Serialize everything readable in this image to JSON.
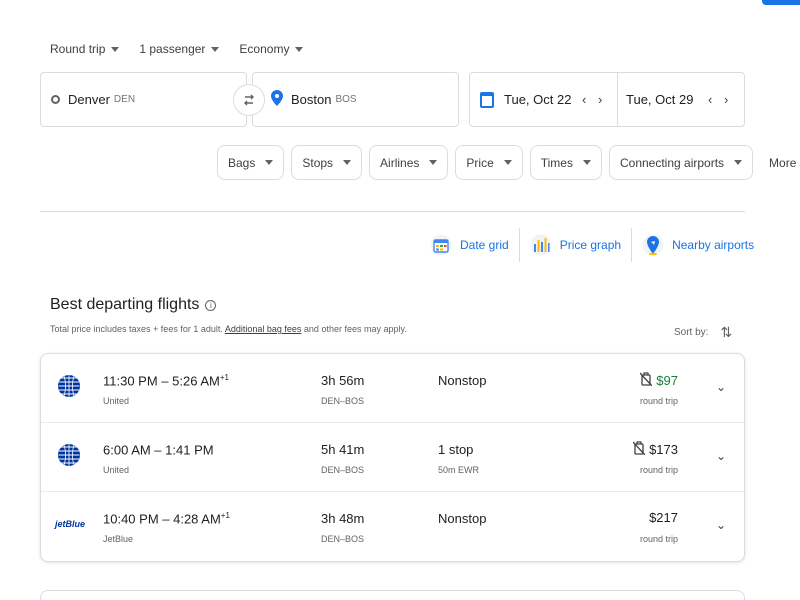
{
  "trip": {
    "type": "Round trip",
    "passengers": "1 passenger",
    "cabin": "Economy"
  },
  "search": {
    "origin_city": "Denver",
    "origin_code": "DEN",
    "dest_city": "Boston",
    "dest_code": "BOS",
    "depart_date": "Tue, Oct 22",
    "return_date": "Tue, Oct 29"
  },
  "filters": [
    "Bags",
    "Stops",
    "Airlines",
    "Price",
    "Times",
    "Connecting airports",
    "More"
  ],
  "tools": {
    "date_grid": "Date grid",
    "price_graph": "Price graph",
    "nearby_airports": "Nearby airports"
  },
  "section": {
    "title": "Best departing flights",
    "subtitle_pre": "Total price includes taxes + fees for 1 adult. ",
    "subtitle_link": "Additional bag fees",
    "subtitle_post": " and other fees may apply.",
    "sort_label": "Sort by:"
  },
  "flights": [
    {
      "airline": "United",
      "time_range": "11:30 PM – 5:26 AM",
      "day_offset": "+1",
      "duration": "3h 56m",
      "route": "DEN–BOS",
      "stops": "Nonstop",
      "layover": "",
      "price": "$97",
      "price_note": "round trip",
      "price_color": "#188038"
    },
    {
      "airline": "United",
      "time_range": "6:00 AM – 1:41 PM",
      "day_offset": "",
      "duration": "5h 41m",
      "route": "DEN–BOS",
      "stops": "1 stop",
      "layover": "50m EWR",
      "price": "$173",
      "price_note": "round trip",
      "price_color": "#202124"
    },
    {
      "airline": "JetBlue",
      "time_range": "10:40 PM – 4:28 AM",
      "day_offset": "+1",
      "duration": "3h 48m",
      "route": "DEN–BOS",
      "stops": "Nonstop",
      "layover": "",
      "price": "$217",
      "price_note": "round trip",
      "price_color": "#202124"
    }
  ],
  "logos": {
    "jetblue_text": "jetBlue"
  },
  "colors": {
    "accent": "#1a73e8",
    "deal_green": "#188038"
  }
}
